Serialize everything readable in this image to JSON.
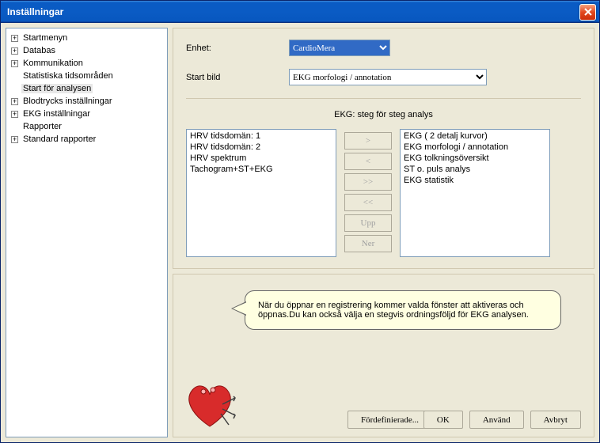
{
  "window": {
    "title": "Inställningar"
  },
  "tree": {
    "items": [
      {
        "label": "Startmenyn",
        "expandable": true
      },
      {
        "label": "Databas",
        "expandable": true
      },
      {
        "label": "Kommunikation",
        "expandable": true
      },
      {
        "label": "Statistiska tidsområden",
        "expandable": false
      },
      {
        "label": "Start för analysen",
        "expandable": false,
        "selected": true
      },
      {
        "label": "Blodtrycks inställningar",
        "expandable": true
      },
      {
        "label": "EKG inställningar",
        "expandable": true
      },
      {
        "label": "Rapporter",
        "expandable": false
      },
      {
        "label": "Standard rapporter",
        "expandable": true
      }
    ]
  },
  "form": {
    "enhet_label": "Enhet:",
    "enhet_value": "CardioMera",
    "startbild_label": "Start bild",
    "startbild_value": "EKG morfologi / annotation",
    "section_title": "EKG: steg för steg analys"
  },
  "left_list": [
    "HRV tidsdomän: 1",
    "HRV tidsdomän: 2",
    "HRV spektrum",
    "Tachogram+ST+EKG"
  ],
  "right_list": [
    "EKG ( 2 detalj kurvor)",
    "EKG morfologi / annotation",
    "EKG tolkningsöversikt",
    "ST o. puls analys",
    "EKG statistik"
  ],
  "move_buttons": {
    "right": ">",
    "left": "<",
    "allright": ">>",
    "allleft": "<<",
    "up": "Upp",
    "down": "Ner"
  },
  "help_text": "När du öppnar en registrering kommer valda fönster att aktiveras och öppnas.Du kan också välja en stegvis ordningsföljd för EKG analysen.",
  "buttons": {
    "predef": "Fördefinierade...",
    "ok": "OK",
    "apply": "Använd",
    "cancel": "Avbryt"
  }
}
